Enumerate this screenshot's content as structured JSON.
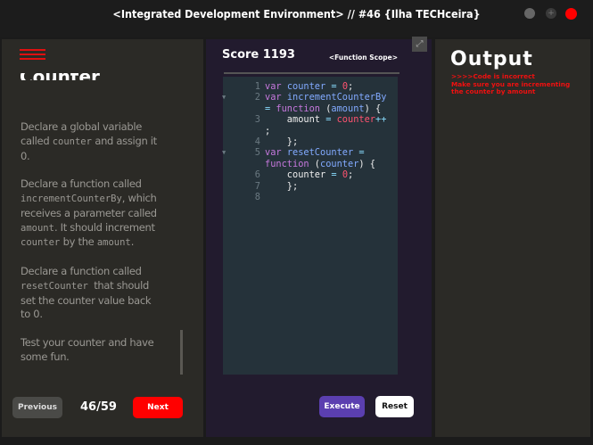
{
  "window": {
    "title": "<Integrated Development Environment> // #46 {Ilha TECHceira}"
  },
  "left": {
    "heading": "Counter",
    "instructions": [
      [
        "Declare a global variable called ",
        {
          "code": "counter"
        },
        " and assign it 0."
      ],
      [
        "Declare a function called ",
        {
          "code": "incrementCounterBy"
        },
        ", which receives a parameter called ",
        {
          "code": "amount"
        },
        ". It should increment ",
        {
          "code": "counter"
        },
        " by the ",
        {
          "code": "amount"
        },
        "."
      ],
      [
        "Declare a function called ",
        {
          "code": "resetCounter "
        },
        " that should set the counter value back to 0."
      ],
      [
        "Test your counter and have some fun."
      ]
    ],
    "previous_label": "Previous",
    "progress": "46/59",
    "next_label": "Next"
  },
  "editor": {
    "score": "Score 1193",
    "scope": "<Function Scope>",
    "lines": [
      {
        "n": "1",
        "fold": false,
        "tokens": [
          [
            "kw",
            "var "
          ],
          [
            "id",
            "counter"
          ],
          [
            "op",
            " = "
          ],
          [
            "num",
            "0"
          ],
          [
            "pl",
            ";"
          ]
        ]
      },
      {
        "n": "2",
        "fold": true,
        "tokens": [
          [
            "kw",
            "var "
          ],
          [
            "id",
            "incrementCounterBy"
          ]
        ]
      },
      {
        "n": "",
        "fold": false,
        "tokens": [
          [
            "op",
            "= "
          ],
          [
            "kw",
            "function "
          ],
          [
            "pl",
            "("
          ],
          [
            "id",
            "amount"
          ],
          [
            "pl",
            ") {"
          ]
        ]
      },
      {
        "n": "3",
        "fold": false,
        "tokens": [
          [
            "pl",
            "    amount "
          ],
          [
            "op",
            "= "
          ],
          [
            "num",
            "counter"
          ],
          [
            "op",
            "++"
          ]
        ]
      },
      {
        "n": "",
        "fold": false,
        "tokens": [
          [
            "pl",
            ";"
          ]
        ]
      },
      {
        "n": "4",
        "fold": false,
        "tokens": [
          [
            "pl",
            "    };"
          ]
        ]
      },
      {
        "n": "5",
        "fold": true,
        "tokens": [
          [
            "kw",
            "var "
          ],
          [
            "id",
            "resetCounter"
          ],
          [
            "op",
            " ="
          ]
        ]
      },
      {
        "n": "",
        "fold": false,
        "tokens": [
          [
            "kw",
            "function "
          ],
          [
            "pl",
            "("
          ],
          [
            "id",
            "counter"
          ],
          [
            "pl",
            ") {"
          ]
        ]
      },
      {
        "n": "6",
        "fold": false,
        "tokens": [
          [
            "pl",
            "    counter "
          ],
          [
            "op",
            "= "
          ],
          [
            "num",
            "0"
          ],
          [
            "pl",
            ";"
          ]
        ]
      },
      {
        "n": "7",
        "fold": false,
        "tokens": [
          [
            "pl",
            "    };"
          ]
        ]
      },
      {
        "n": "8",
        "fold": false,
        "tokens": []
      }
    ],
    "execute_label": "Execute",
    "reset_label": "Reset"
  },
  "output": {
    "title": "Output",
    "messages": [
      ">>>>Code is incorrect",
      "Make sure you are incrementing",
      "the counter by amount"
    ]
  },
  "colors": {
    "accent_red": "#ff0000",
    "execute": "#5b3fb0"
  }
}
